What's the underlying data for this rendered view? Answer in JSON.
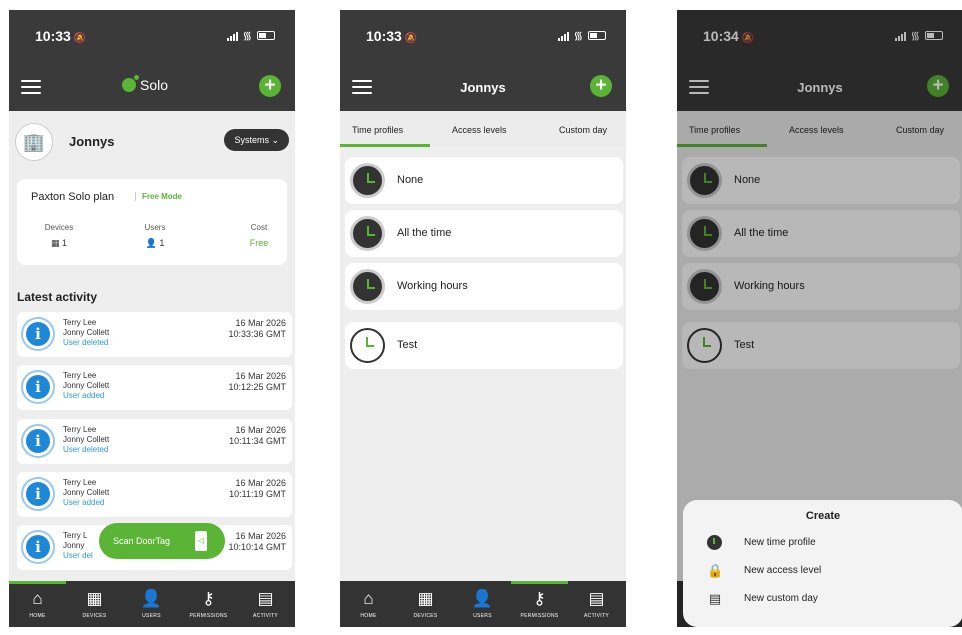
{
  "colors": {
    "accent": "#5ab435",
    "dark": "#3a3a3a",
    "info_blue": "#1e88d6",
    "link_blue": "#2e9ad6"
  },
  "screens": [
    {
      "status_time": "10:33",
      "brand": "Solo",
      "org": {
        "name": "Jonnys",
        "systems_label": "Systems ⌄"
      },
      "plan": {
        "name": "Paxton Solo plan",
        "mode": "Free Mode",
        "stats": [
          {
            "label": "Devices",
            "value": "1"
          },
          {
            "label": "Users",
            "value": "1"
          },
          {
            "label": "Cost",
            "value": "Free"
          }
        ]
      },
      "latest_title": "Latest activity",
      "activity": [
        {
          "who": "Terry Lee",
          "by": "Jonny Collett",
          "action": "User deleted",
          "date": "16 Mar 2026",
          "time": "10:33:36 GMT"
        },
        {
          "who": "Terry Lee",
          "by": "Jonny Collett",
          "action": "User added",
          "date": "16 Mar 2026",
          "time": "10:12:25 GMT"
        },
        {
          "who": "Terry Lee",
          "by": "Jonny Collett",
          "action": "User deleted",
          "date": "16 Mar 2026",
          "time": "10:11:34 GMT"
        },
        {
          "who": "Terry Lee",
          "by": "Jonny Collett",
          "action": "User added",
          "date": "16 Mar 2026",
          "time": "10:11:19 GMT"
        },
        {
          "who": "Terry L",
          "by": "Jonny",
          "action": "User del",
          "date": "16 Mar 2026",
          "time": "10:10:14 GMT"
        }
      ],
      "scan_label": "Scan DoorTag"
    },
    {
      "status_time": "10:33",
      "title": "Jonnys",
      "tabs": [
        "Time profiles",
        "Access levels",
        "Custom day"
      ],
      "profiles": [
        "None",
        "All the time",
        "Working hours",
        "Test"
      ]
    },
    {
      "status_time": "10:34",
      "title": "Jonnys",
      "tabs": [
        "Time profiles",
        "Access levels",
        "Custom day"
      ],
      "profiles": [
        "None",
        "All the time",
        "Working hours",
        "Test"
      ],
      "sheet": {
        "title": "Create",
        "items": [
          "New time profile",
          "New access level",
          "New custom day"
        ]
      }
    }
  ],
  "nav": [
    {
      "label": "HOME",
      "icon": "home-icon"
    },
    {
      "label": "DEVICES",
      "icon": "devices-icon"
    },
    {
      "label": "USERS",
      "icon": "user-icon"
    },
    {
      "label": "PERMISSIONS",
      "icon": "key-icon"
    },
    {
      "label": "ACTIVITY",
      "icon": "calendar-icon"
    }
  ]
}
